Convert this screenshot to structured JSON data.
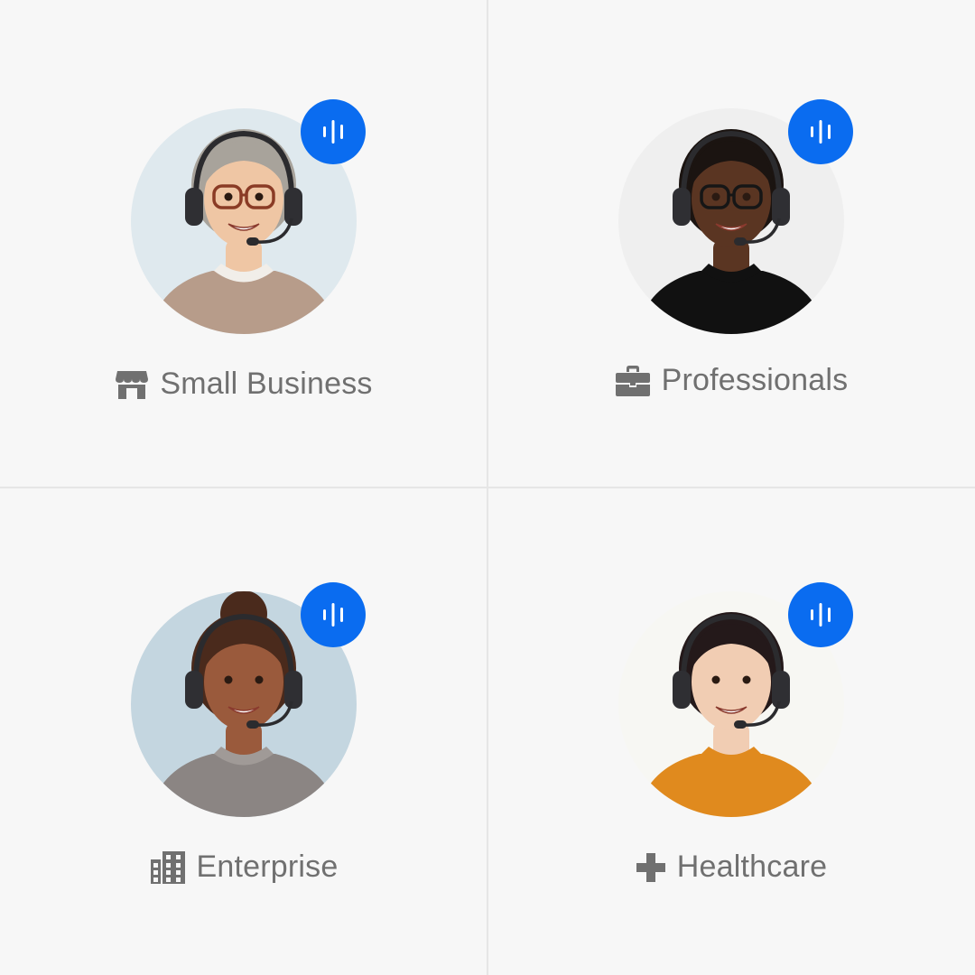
{
  "categories": [
    {
      "label": "Small Business",
      "icon": "store-icon",
      "avatar": {
        "bg": "#dfe9ee",
        "skin": "#efc6a4",
        "hair": "#a8a39b",
        "shirt": "#b79c8a",
        "collar": "#f1eee9",
        "glasses": "#8a3b25"
      }
    },
    {
      "label": "Professionals",
      "icon": "briefcase-icon",
      "avatar": {
        "bg": "#efefef",
        "skin": "#5a3522",
        "hair": "#1b1411",
        "shirt": "#111111",
        "collar": "#111111",
        "glasses": "#161616"
      }
    },
    {
      "label": "Enterprise",
      "icon": "building-icon",
      "avatar": {
        "bg": "#c4d6e0",
        "skin": "#9a5a3c",
        "hair": "#4a2a1c",
        "shirt": "#8b8583",
        "collar": "#a09a97",
        "glasses": ""
      }
    },
    {
      "label": "Healthcare",
      "icon": "plus-icon",
      "avatar": {
        "bg": "#f7f7f3",
        "skin": "#f1cdb3",
        "hair": "#24191a",
        "shirt": "#e08a1e",
        "collar": "#e08a1e",
        "glasses": ""
      }
    }
  ],
  "colors": {
    "accent": "#0a6cf0",
    "label_text": "#707070",
    "background": "#f7f7f7",
    "divider": "#e6e6e6"
  }
}
